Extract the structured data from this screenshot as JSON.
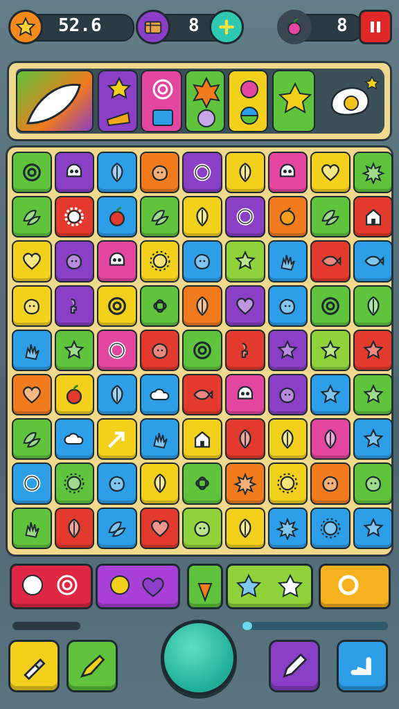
{
  "top": {
    "score": "52.6",
    "boxes": "8",
    "fruit": "8"
  },
  "colors": {
    "green": "#5fc43c",
    "purple": "#8a3fc6",
    "blue": "#2d9ee8",
    "orange": "#f07a1c",
    "pink": "#e2469e",
    "yellow": "#f3d01c",
    "red": "#e23a2c",
    "lime": "#8fd23a"
  },
  "board": {
    "rows": [
      [
        "green",
        "purple",
        "blue",
        "orange",
        "purple",
        "yellow",
        "pink",
        "yellow",
        "green"
      ],
      [
        "green",
        "red",
        "blue",
        "green",
        "yellow",
        "purple",
        "orange",
        "green",
        "red"
      ],
      [
        "yellow",
        "purple",
        "pink",
        "yellow",
        "blue",
        "lime",
        "blue",
        "red",
        "blue"
      ],
      [
        "yellow",
        "purple",
        "yellow",
        "green",
        "orange",
        "purple",
        "blue",
        "green",
        "green"
      ],
      [
        "blue",
        "green",
        "pink",
        "red",
        "green",
        "red",
        "purple",
        "lime",
        "red"
      ],
      [
        "orange",
        "yellow",
        "blue",
        "blue",
        "red",
        "pink",
        "purple",
        "blue",
        "green"
      ],
      [
        "green",
        "blue",
        "yellow",
        "blue",
        "yellow",
        "red",
        "yellow",
        "pink",
        "blue"
      ],
      [
        "blue",
        "green",
        "blue",
        "yellow",
        "green",
        "orange",
        "yellow",
        "orange",
        "green"
      ],
      [
        "green",
        "red",
        "blue",
        "red",
        "lime",
        "yellow",
        "blue",
        "blue",
        "blue"
      ]
    ],
    "icons": [
      [
        "spiral",
        "skull",
        "leaf",
        "blob",
        "ring",
        "leaf",
        "skull",
        "heart",
        "splat"
      ],
      [
        "leafpair",
        "gear",
        "apple",
        "leafpair",
        "leaf",
        "ring",
        "orange",
        "leafpair",
        "house"
      ],
      [
        "heart",
        "blob",
        "skull",
        "sun",
        "blob",
        "star",
        "hand",
        "fish",
        "fish"
      ],
      [
        "blob",
        "key",
        "spiral",
        "knot",
        "leaf",
        "heart",
        "blob",
        "spiral",
        "leaf"
      ],
      [
        "hand",
        "star",
        "ring",
        "blob",
        "spiral",
        "key",
        "star",
        "star",
        "star"
      ],
      [
        "heart",
        "apple",
        "leaf",
        "cloud",
        "fish",
        "skull",
        "blob",
        "star",
        "star"
      ],
      [
        "leafpair",
        "cloud",
        "arrow",
        "hand",
        "house",
        "leaf",
        "leaf",
        "leaf",
        "star"
      ],
      [
        "ring",
        "sun",
        "blob",
        "leaf",
        "knot",
        "splat",
        "sun",
        "blob",
        "blob"
      ],
      [
        "hand",
        "leaf",
        "leafpair",
        "heart",
        "blob",
        "leaf",
        "splat",
        "sun",
        "star"
      ]
    ]
  }
}
